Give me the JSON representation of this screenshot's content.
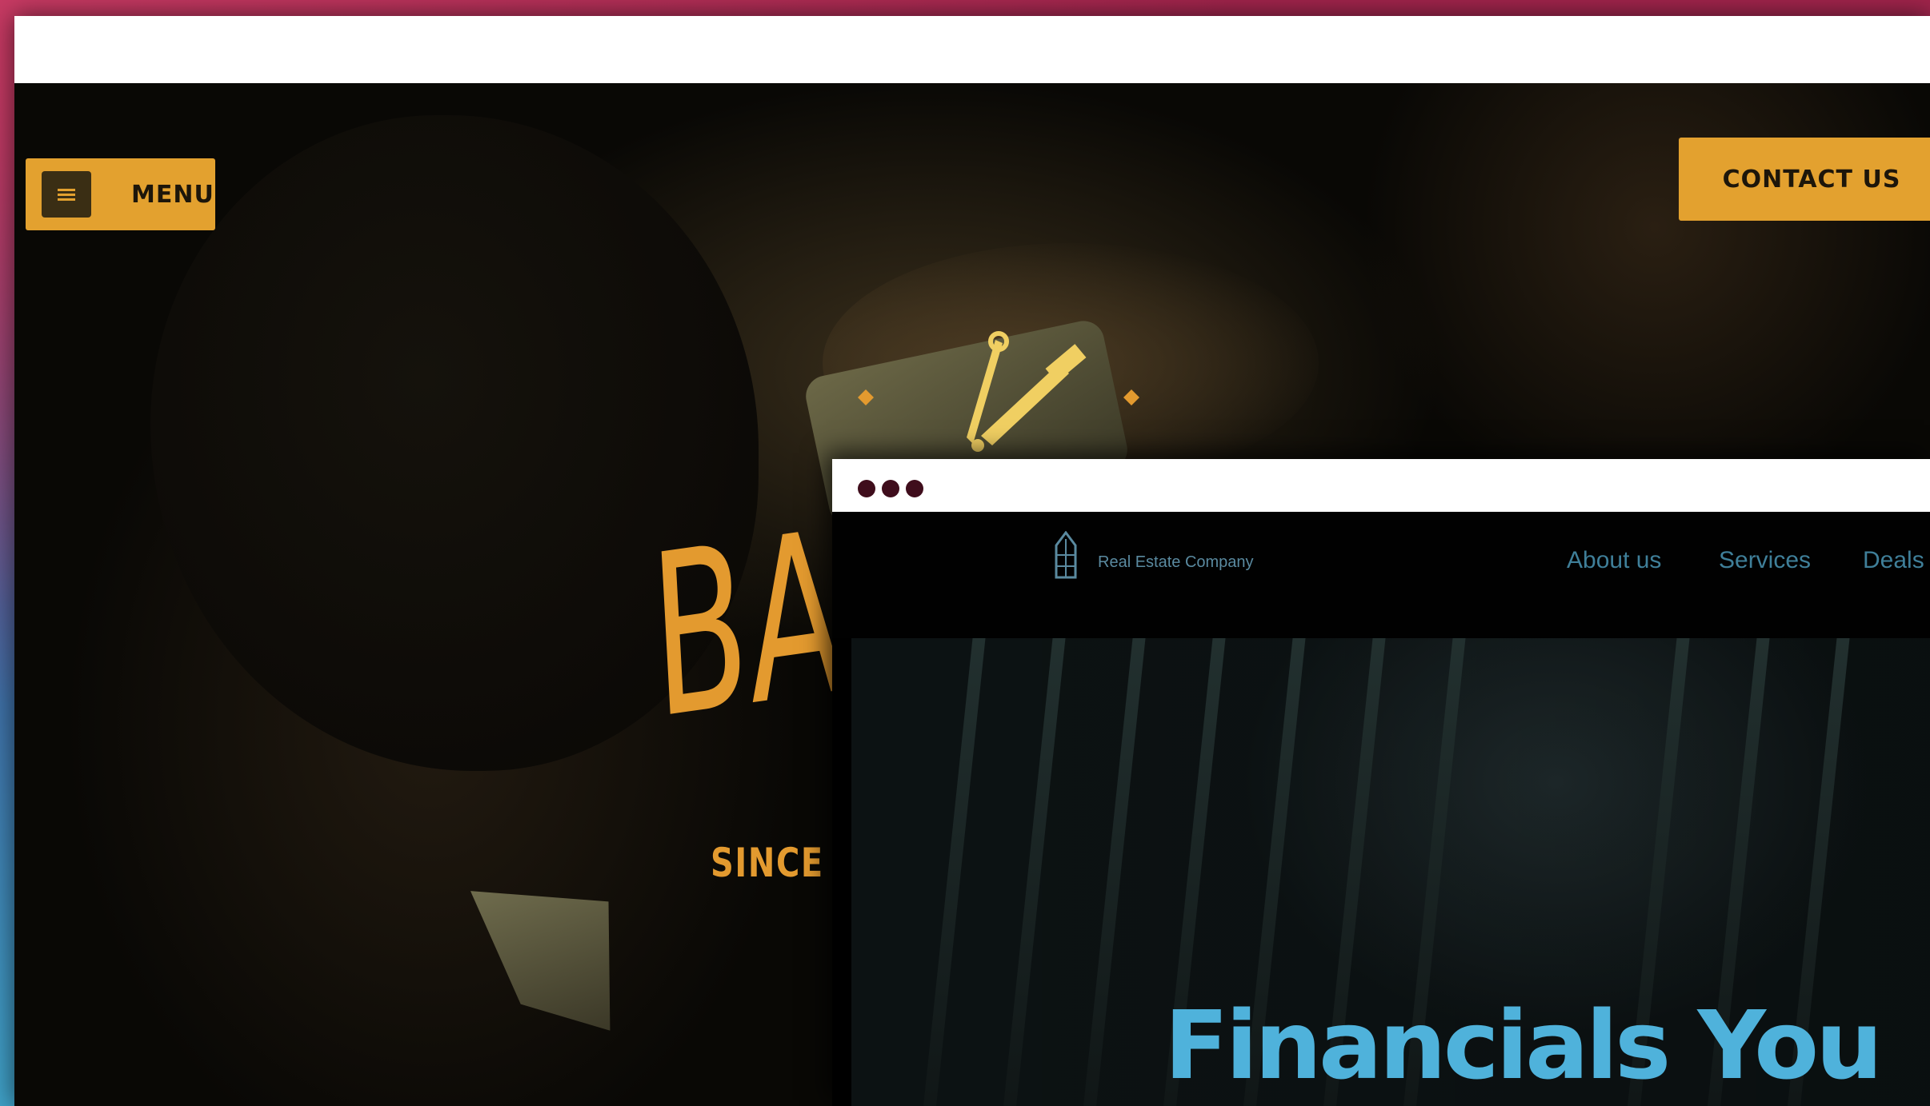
{
  "back_site": {
    "menu_label": "MENU",
    "contact_label": "CONTACT US",
    "hero_title": "BA",
    "hero_subtitle": "SINCE"
  },
  "front_site": {
    "brand_name": "Real Estate Company",
    "nav": [
      {
        "label": "About us"
      },
      {
        "label": "Services"
      },
      {
        "label": "Deals"
      }
    ],
    "headline": "Financials You"
  },
  "colors": {
    "accent_gold": "#e3a12f",
    "headline_blue": "#4fb2db",
    "window_dot": "#3f0d1c"
  },
  "icons": [
    "hamburger-menu-icon",
    "razor-logo-icon",
    "building-logo-icon"
  ]
}
